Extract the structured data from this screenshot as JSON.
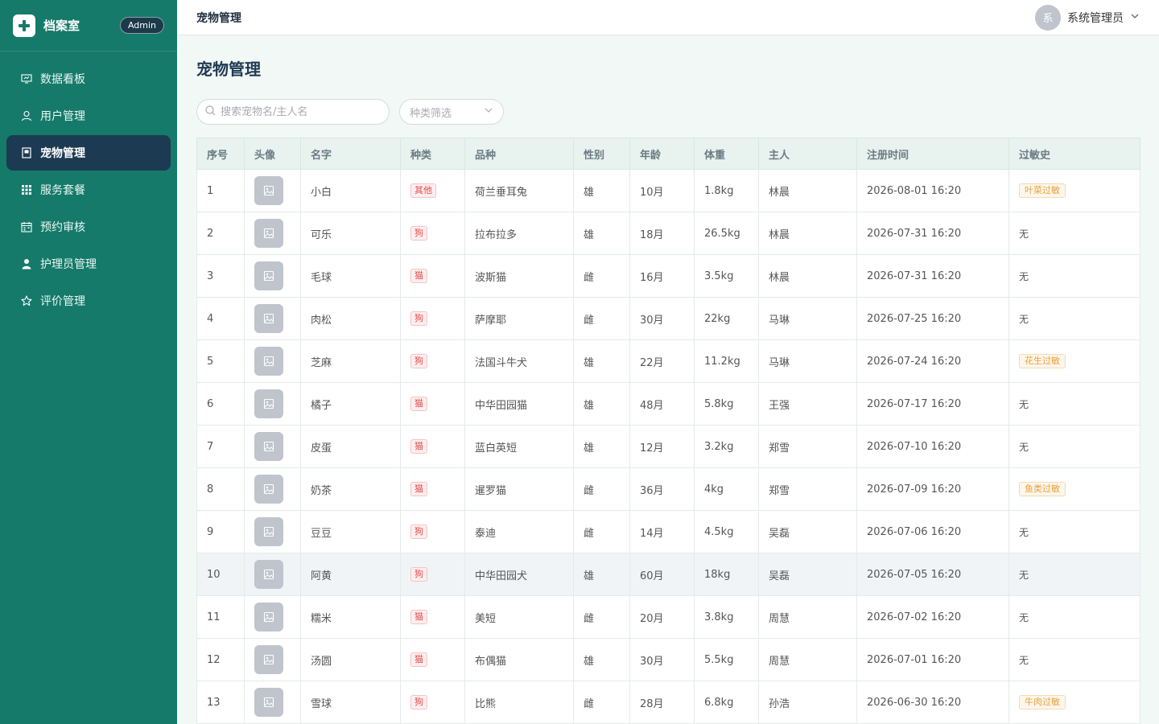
{
  "sidebar": {
    "brand_title": "档案室",
    "admin_badge": "Admin",
    "items": [
      {
        "label": "数据看板",
        "icon": "dashboard-icon",
        "active": false
      },
      {
        "label": "用户管理",
        "icon": "user-icon",
        "active": false
      },
      {
        "label": "宠物管理",
        "icon": "pet-record-icon",
        "active": true
      },
      {
        "label": "服务套餐",
        "icon": "grid-icon",
        "active": false
      },
      {
        "label": "预约审核",
        "icon": "calendar-icon",
        "active": false
      },
      {
        "label": "护理员管理",
        "icon": "caregiver-icon",
        "active": false
      },
      {
        "label": "评价管理",
        "icon": "star-icon",
        "active": false
      }
    ]
  },
  "header": {
    "title": "宠物管理",
    "user_avatar_text": "系",
    "user_name": "系统管理员"
  },
  "page": {
    "title": "宠物管理",
    "search_placeholder": "搜索宠物名/主人名",
    "type_filter_placeholder": "种类筛选"
  },
  "table": {
    "columns": [
      "序号",
      "头像",
      "名字",
      "种类",
      "品种",
      "性别",
      "年龄",
      "体重",
      "主人",
      "注册时间",
      "过敏史"
    ],
    "rows": [
      {
        "no": "1",
        "name": "小白",
        "type": "其他",
        "breed": "荷兰垂耳兔",
        "gender": "雄",
        "age": "10月",
        "weight": "1.8kg",
        "owner": "林晨",
        "registered": "2026-08-01 16:20",
        "allergy": "叶菜过敏",
        "has_allergy": true
      },
      {
        "no": "2",
        "name": "可乐",
        "type": "狗",
        "breed": "拉布拉多",
        "gender": "雄",
        "age": "18月",
        "weight": "26.5kg",
        "owner": "林晨",
        "registered": "2026-07-31 16:20",
        "allergy": "无",
        "has_allergy": false
      },
      {
        "no": "3",
        "name": "毛球",
        "type": "猫",
        "breed": "波斯猫",
        "gender": "雌",
        "age": "16月",
        "weight": "3.5kg",
        "owner": "林晨",
        "registered": "2026-07-31 16:20",
        "allergy": "无",
        "has_allergy": false
      },
      {
        "no": "4",
        "name": "肉松",
        "type": "狗",
        "breed": "萨摩耶",
        "gender": "雌",
        "age": "30月",
        "weight": "22kg",
        "owner": "马琳",
        "registered": "2026-07-25 16:20",
        "allergy": "无",
        "has_allergy": false
      },
      {
        "no": "5",
        "name": "芝麻",
        "type": "狗",
        "breed": "法国斗牛犬",
        "gender": "雄",
        "age": "22月",
        "weight": "11.2kg",
        "owner": "马琳",
        "registered": "2026-07-24 16:20",
        "allergy": "花生过敏",
        "has_allergy": true
      },
      {
        "no": "6",
        "name": "橘子",
        "type": "猫",
        "breed": "中华田园猫",
        "gender": "雄",
        "age": "48月",
        "weight": "5.8kg",
        "owner": "王强",
        "registered": "2026-07-17 16:20",
        "allergy": "无",
        "has_allergy": false
      },
      {
        "no": "7",
        "name": "皮蛋",
        "type": "猫",
        "breed": "蓝白英短",
        "gender": "雄",
        "age": "12月",
        "weight": "3.2kg",
        "owner": "郑雪",
        "registered": "2026-07-10 16:20",
        "allergy": "无",
        "has_allergy": false
      },
      {
        "no": "8",
        "name": "奶茶",
        "type": "猫",
        "breed": "暹罗猫",
        "gender": "雌",
        "age": "36月",
        "weight": "4kg",
        "owner": "郑雪",
        "registered": "2026-07-09 16:20",
        "allergy": "鱼类过敏",
        "has_allergy": true
      },
      {
        "no": "9",
        "name": "豆豆",
        "type": "狗",
        "breed": "泰迪",
        "gender": "雌",
        "age": "14月",
        "weight": "4.5kg",
        "owner": "吴磊",
        "registered": "2026-07-06 16:20",
        "allergy": "无",
        "has_allergy": false
      },
      {
        "no": "10",
        "name": "阿黄",
        "type": "狗",
        "breed": "中华田园犬",
        "gender": "雄",
        "age": "60月",
        "weight": "18kg",
        "owner": "吴磊",
        "registered": "2026-07-05 16:20",
        "allergy": "无",
        "has_allergy": false,
        "hovered": true
      },
      {
        "no": "11",
        "name": "糯米",
        "type": "猫",
        "breed": "美短",
        "gender": "雌",
        "age": "20月",
        "weight": "3.8kg",
        "owner": "周慧",
        "registered": "2026-07-02 16:20",
        "allergy": "无",
        "has_allergy": false
      },
      {
        "no": "12",
        "name": "汤圆",
        "type": "猫",
        "breed": "布偶猫",
        "gender": "雄",
        "age": "30月",
        "weight": "5.5kg",
        "owner": "周慧",
        "registered": "2026-07-01 16:20",
        "allergy": "无",
        "has_allergy": false
      },
      {
        "no": "13",
        "name": "雪球",
        "type": "狗",
        "breed": "比熊",
        "gender": "雌",
        "age": "28月",
        "weight": "6.8kg",
        "owner": "孙浩",
        "registered": "2026-06-30 16:20",
        "allergy": "牛肉过敏",
        "has_allergy": true
      }
    ]
  },
  "colors": {
    "sidebar_bg": "#157a6a",
    "active_nav_bg": "#1c3a52",
    "type_tag": "#e04c4c",
    "allergy_tag": "#e6a23c"
  }
}
